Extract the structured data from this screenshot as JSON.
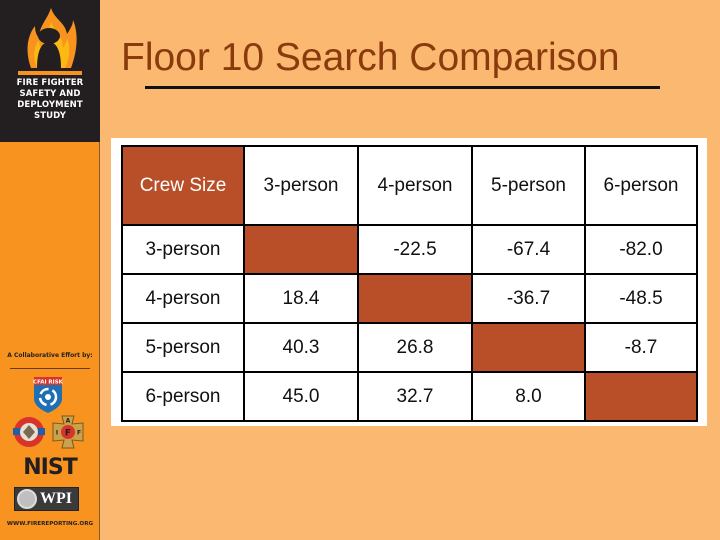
{
  "sidebar": {
    "logo": {
      "icon": "firefighter-flame-icon",
      "lines": [
        "FIRE FIGHTER",
        "SAFETY AND",
        "DEPLOYMENT",
        "STUDY"
      ]
    },
    "collaborative_label": "A Collaborative Effort by:",
    "partners": [
      {
        "name": "CFAI RISK",
        "icon": "cfai-risk-shield-icon"
      },
      {
        "name": "IAFC",
        "icon": "iafc-seal-icon"
      },
      {
        "name": "IAFF",
        "icon": "iaff-maltese-cross-icon"
      },
      {
        "name": "NIST",
        "icon": "nist-logo"
      },
      {
        "name": "WPI",
        "icon": "wpi-logo"
      }
    ],
    "cfai_label": "CFAI RISK",
    "iaff_letters": [
      "A",
      "I",
      "F",
      "F"
    ],
    "nist_label": "NIST",
    "wpi_label": "WPI",
    "website": "WWW.FIREREPORTING.ORG"
  },
  "slide": {
    "title": "Floor 10 Search Comparison"
  },
  "table": {
    "corner_label": "Crew Size",
    "columns": [
      "3-person",
      "4-person",
      "5-person",
      "6-person"
    ],
    "rows": [
      {
        "label": "3-person",
        "cells": [
          "",
          "-22.5",
          "-67.4",
          "-82.0"
        ]
      },
      {
        "label": "4-person",
        "cells": [
          "18.4",
          "",
          "-36.7",
          "-48.5"
        ]
      },
      {
        "label": "5-person",
        "cells": [
          "40.3",
          "26.8",
          "",
          "-8.7"
        ]
      },
      {
        "label": "6-person",
        "cells": [
          "45.0",
          "32.7",
          "8.0",
          ""
        ]
      }
    ],
    "colors": {
      "shade": "#b84f28",
      "title": "#8b3a0d",
      "background": "#fbb870",
      "sidebar": "#f7931e"
    }
  }
}
